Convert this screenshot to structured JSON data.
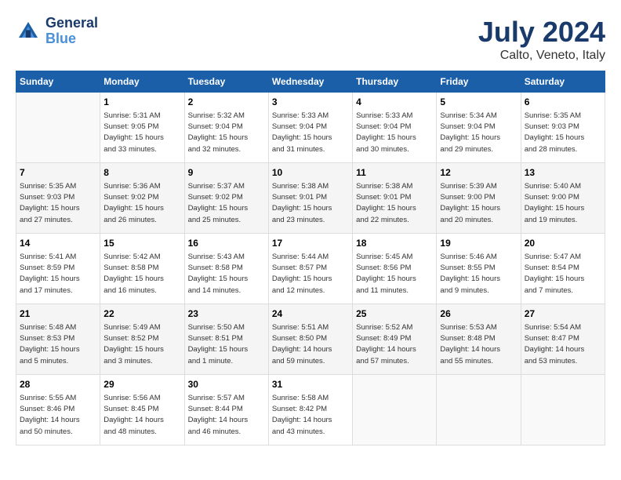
{
  "logo": {
    "line1": "General",
    "line2": "Blue"
  },
  "title": "July 2024",
  "location": "Calto, Veneto, Italy",
  "days_of_week": [
    "Sunday",
    "Monday",
    "Tuesday",
    "Wednesday",
    "Thursday",
    "Friday",
    "Saturday"
  ],
  "weeks": [
    [
      {
        "day": "",
        "info": ""
      },
      {
        "day": "1",
        "info": "Sunrise: 5:31 AM\nSunset: 9:05 PM\nDaylight: 15 hours\nand 33 minutes."
      },
      {
        "day": "2",
        "info": "Sunrise: 5:32 AM\nSunset: 9:04 PM\nDaylight: 15 hours\nand 32 minutes."
      },
      {
        "day": "3",
        "info": "Sunrise: 5:33 AM\nSunset: 9:04 PM\nDaylight: 15 hours\nand 31 minutes."
      },
      {
        "day": "4",
        "info": "Sunrise: 5:33 AM\nSunset: 9:04 PM\nDaylight: 15 hours\nand 30 minutes."
      },
      {
        "day": "5",
        "info": "Sunrise: 5:34 AM\nSunset: 9:04 PM\nDaylight: 15 hours\nand 29 minutes."
      },
      {
        "day": "6",
        "info": "Sunrise: 5:35 AM\nSunset: 9:03 PM\nDaylight: 15 hours\nand 28 minutes."
      }
    ],
    [
      {
        "day": "7",
        "info": "Sunrise: 5:35 AM\nSunset: 9:03 PM\nDaylight: 15 hours\nand 27 minutes."
      },
      {
        "day": "8",
        "info": "Sunrise: 5:36 AM\nSunset: 9:02 PM\nDaylight: 15 hours\nand 26 minutes."
      },
      {
        "day": "9",
        "info": "Sunrise: 5:37 AM\nSunset: 9:02 PM\nDaylight: 15 hours\nand 25 minutes."
      },
      {
        "day": "10",
        "info": "Sunrise: 5:38 AM\nSunset: 9:01 PM\nDaylight: 15 hours\nand 23 minutes."
      },
      {
        "day": "11",
        "info": "Sunrise: 5:38 AM\nSunset: 9:01 PM\nDaylight: 15 hours\nand 22 minutes."
      },
      {
        "day": "12",
        "info": "Sunrise: 5:39 AM\nSunset: 9:00 PM\nDaylight: 15 hours\nand 20 minutes."
      },
      {
        "day": "13",
        "info": "Sunrise: 5:40 AM\nSunset: 9:00 PM\nDaylight: 15 hours\nand 19 minutes."
      }
    ],
    [
      {
        "day": "14",
        "info": "Sunrise: 5:41 AM\nSunset: 8:59 PM\nDaylight: 15 hours\nand 17 minutes."
      },
      {
        "day": "15",
        "info": "Sunrise: 5:42 AM\nSunset: 8:58 PM\nDaylight: 15 hours\nand 16 minutes."
      },
      {
        "day": "16",
        "info": "Sunrise: 5:43 AM\nSunset: 8:58 PM\nDaylight: 15 hours\nand 14 minutes."
      },
      {
        "day": "17",
        "info": "Sunrise: 5:44 AM\nSunset: 8:57 PM\nDaylight: 15 hours\nand 12 minutes."
      },
      {
        "day": "18",
        "info": "Sunrise: 5:45 AM\nSunset: 8:56 PM\nDaylight: 15 hours\nand 11 minutes."
      },
      {
        "day": "19",
        "info": "Sunrise: 5:46 AM\nSunset: 8:55 PM\nDaylight: 15 hours\nand 9 minutes."
      },
      {
        "day": "20",
        "info": "Sunrise: 5:47 AM\nSunset: 8:54 PM\nDaylight: 15 hours\nand 7 minutes."
      }
    ],
    [
      {
        "day": "21",
        "info": "Sunrise: 5:48 AM\nSunset: 8:53 PM\nDaylight: 15 hours\nand 5 minutes."
      },
      {
        "day": "22",
        "info": "Sunrise: 5:49 AM\nSunset: 8:52 PM\nDaylight: 15 hours\nand 3 minutes."
      },
      {
        "day": "23",
        "info": "Sunrise: 5:50 AM\nSunset: 8:51 PM\nDaylight: 15 hours\nand 1 minute."
      },
      {
        "day": "24",
        "info": "Sunrise: 5:51 AM\nSunset: 8:50 PM\nDaylight: 14 hours\nand 59 minutes."
      },
      {
        "day": "25",
        "info": "Sunrise: 5:52 AM\nSunset: 8:49 PM\nDaylight: 14 hours\nand 57 minutes."
      },
      {
        "day": "26",
        "info": "Sunrise: 5:53 AM\nSunset: 8:48 PM\nDaylight: 14 hours\nand 55 minutes."
      },
      {
        "day": "27",
        "info": "Sunrise: 5:54 AM\nSunset: 8:47 PM\nDaylight: 14 hours\nand 53 minutes."
      }
    ],
    [
      {
        "day": "28",
        "info": "Sunrise: 5:55 AM\nSunset: 8:46 PM\nDaylight: 14 hours\nand 50 minutes."
      },
      {
        "day": "29",
        "info": "Sunrise: 5:56 AM\nSunset: 8:45 PM\nDaylight: 14 hours\nand 48 minutes."
      },
      {
        "day": "30",
        "info": "Sunrise: 5:57 AM\nSunset: 8:44 PM\nDaylight: 14 hours\nand 46 minutes."
      },
      {
        "day": "31",
        "info": "Sunrise: 5:58 AM\nSunset: 8:42 PM\nDaylight: 14 hours\nand 43 minutes."
      },
      {
        "day": "",
        "info": ""
      },
      {
        "day": "",
        "info": ""
      },
      {
        "day": "",
        "info": ""
      }
    ]
  ]
}
